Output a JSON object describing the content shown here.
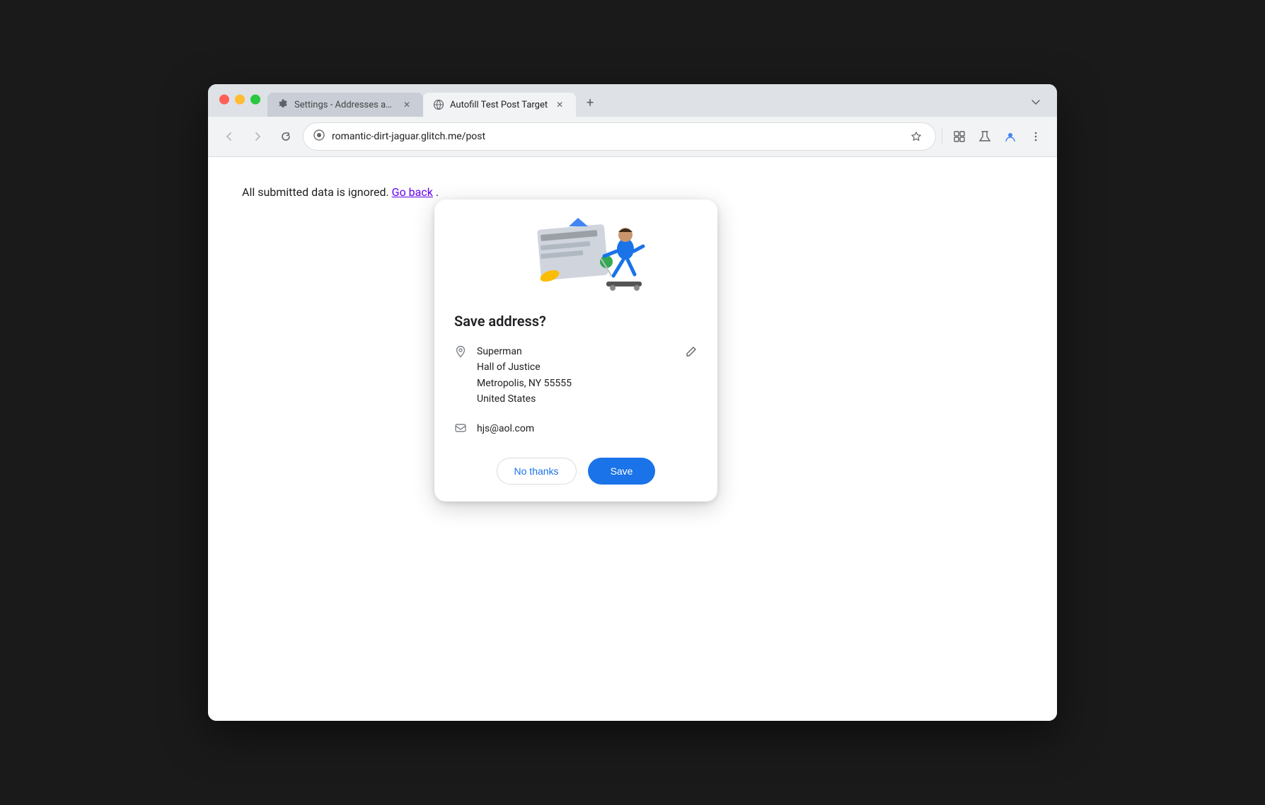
{
  "browser": {
    "tabs": [
      {
        "id": "settings-tab",
        "title": "Settings - Addresses and mo",
        "icon": "settings-icon",
        "active": false
      },
      {
        "id": "autofill-tab",
        "title": "Autofill Test Post Target",
        "icon": "globe-icon",
        "active": true
      }
    ],
    "new_tab_label": "+",
    "url": "romantic-dirt-jaguar.glitch.me/post"
  },
  "page": {
    "main_text": "All submitted data is ignored.",
    "go_back_label": "Go back"
  },
  "popup": {
    "title": "Save address?",
    "close_label": "×",
    "address": {
      "name": "Superman",
      "line1": "Hall of Justice",
      "line2": "Metropolis, NY 55555",
      "country": "United States"
    },
    "email": "hjs@aol.com",
    "buttons": {
      "no_thanks": "No thanks",
      "save": "Save"
    }
  },
  "nav": {
    "back_title": "Back",
    "forward_title": "Forward",
    "reload_title": "Reload"
  }
}
